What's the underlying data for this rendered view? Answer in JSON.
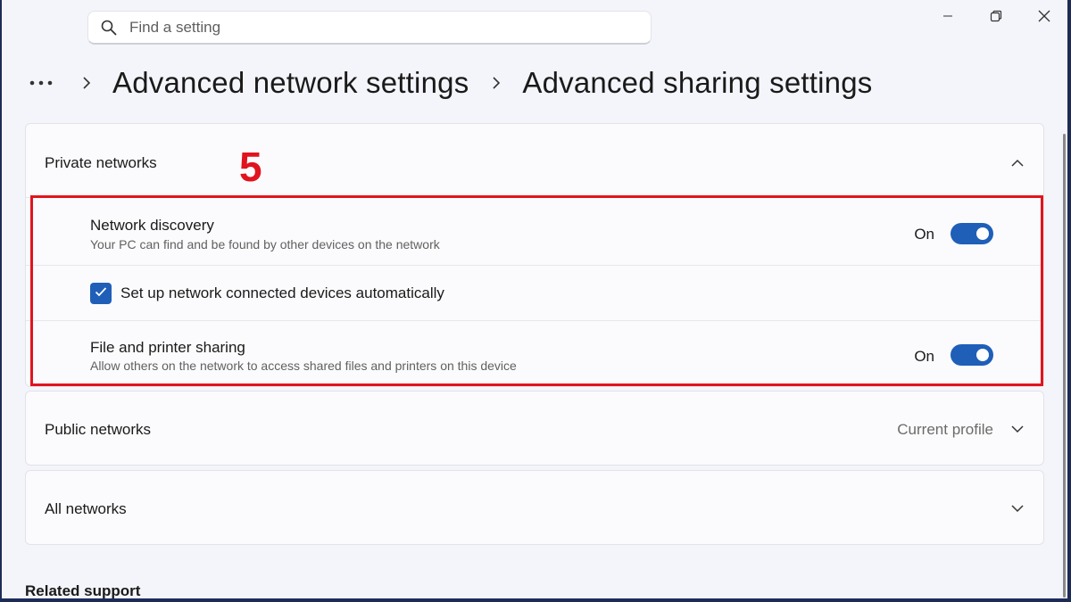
{
  "search": {
    "placeholder": "Find a setting",
    "icon": "search-icon"
  },
  "breadcrumb": {
    "items": [
      "Advanced network settings",
      "Advanced sharing settings"
    ]
  },
  "annotation": {
    "step_number": "5",
    "highlight_color": "#e0141e"
  },
  "accent_color": "#1f5fb8",
  "private_networks": {
    "label": "Private networks",
    "expanded": true,
    "network_discovery": {
      "title": "Network discovery",
      "subtitle": "Your PC can find and be found by other devices on the network",
      "state_label": "On",
      "on": true
    },
    "auto_setup": {
      "label": "Set up network connected devices automatically",
      "checked": true
    },
    "file_sharing": {
      "title": "File and printer sharing",
      "subtitle": "Allow others on the network to access shared files and printers on this device",
      "state_label": "On",
      "on": true
    }
  },
  "public_networks": {
    "label": "Public networks",
    "status": "Current profile"
  },
  "all_networks": {
    "label": "All networks"
  },
  "related_support": {
    "label": "Related support"
  }
}
